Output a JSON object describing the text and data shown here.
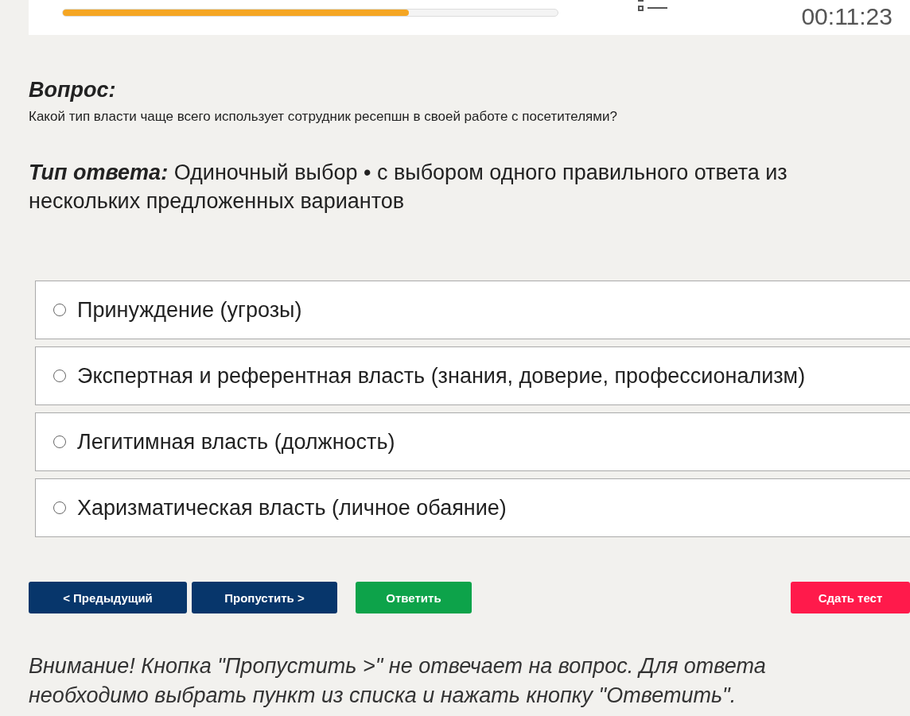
{
  "header": {
    "progress": {
      "level": 0.7
    },
    "timer": "00:11:23"
  },
  "question": {
    "heading": "Вопрос:",
    "text": "Какой тип власти чаще всего использует сотрудник ресепшн в своей работе с посетителями?"
  },
  "answer_type": {
    "label": "Тип ответа:",
    "text": "Одиночный выбор • с выбором одного правильного ответа из нескольких предложенных вариантов"
  },
  "options": [
    {
      "label": "Принуждение (угрозы)",
      "selected": false
    },
    {
      "label": "Экспертная и референтная власть (знания, доверие, профессионализм)",
      "selected": false
    },
    {
      "label": "Легитимная власть (должность)",
      "selected": false
    },
    {
      "label": "Харизматическая власть (личное обаяние)",
      "selected": false
    }
  ],
  "buttons": [
    {
      "label": "< Предыдущий",
      "kind": "nav"
    },
    {
      "label": "Пропустить >",
      "kind": "nav"
    },
    {
      "label": "Ответить",
      "kind": "answer"
    },
    {
      "label": "Сдать тест",
      "kind": "finish"
    }
  ],
  "note": "Внимание! Кнопка \"Пропустить >\" не отвечает на вопрос. Для ответа необходимо выбрать пункт из списка и нажать кнопку \"Ответить\"."
}
